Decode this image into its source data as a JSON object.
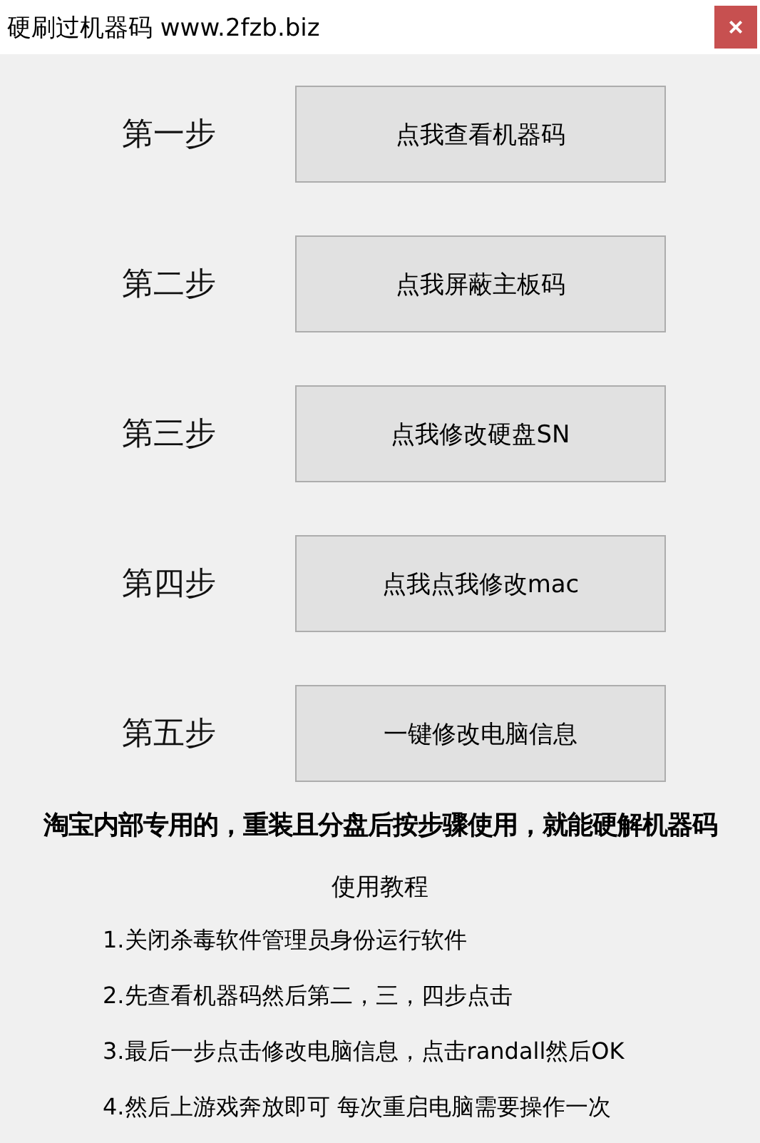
{
  "window": {
    "title": "硬刷过机器码 www.2fzb.biz",
    "close": "×"
  },
  "steps": [
    {
      "label": "第一步",
      "button": "点我查看机器码"
    },
    {
      "label": "第二步",
      "button": "点我屏蔽主板码"
    },
    {
      "label": "第三步",
      "button": "点我修改硬盘SN"
    },
    {
      "label": "第四步",
      "button": "点我点我修改mac"
    },
    {
      "label": "第五步",
      "button": "一键修改电脑信息"
    }
  ],
  "notice": "淘宝内部专用的，重装且分盘后按步骤使用，就能硬解机器码",
  "tutorial": {
    "title": "使用教程",
    "lines": [
      "1.关闭杀毒软件管理员身份运行软件",
      "2.先查看机器码然后第二，三，四步点击",
      "3.最后一步点击修改电脑信息，点击randall然后OK",
      "4.然后上游戏奔放即可 每次重启电脑需要操作一次"
    ]
  }
}
